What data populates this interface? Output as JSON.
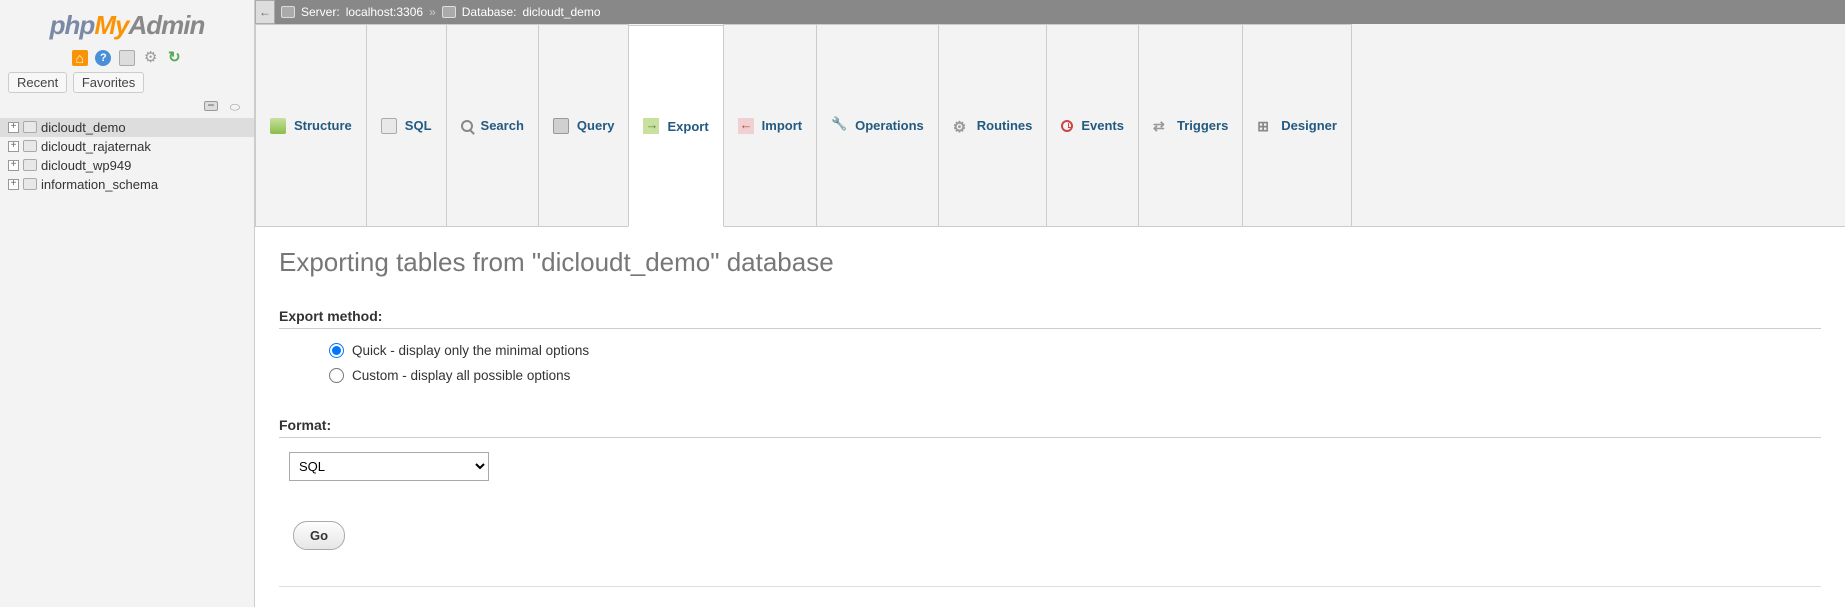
{
  "logo": {
    "part1": "php",
    "part2": "My",
    "part3": "Admin"
  },
  "sidebar": {
    "tabs": {
      "recent": "Recent",
      "favorites": "Favorites"
    },
    "databases": [
      {
        "name": "dicloudt_demo",
        "selected": true
      },
      {
        "name": "dicloudt_rajaternak",
        "selected": false
      },
      {
        "name": "dicloudt_wp949",
        "selected": false
      },
      {
        "name": "information_schema",
        "selected": false
      }
    ]
  },
  "breadcrumb": {
    "server_label": "Server:",
    "server_value": "localhost:3306",
    "db_label": "Database:",
    "db_value": "dicloudt_demo",
    "sep": "»"
  },
  "tabs": [
    {
      "key": "structure",
      "label": "Structure"
    },
    {
      "key": "sql",
      "label": "SQL"
    },
    {
      "key": "search",
      "label": "Search"
    },
    {
      "key": "query",
      "label": "Query"
    },
    {
      "key": "export",
      "label": "Export",
      "active": true
    },
    {
      "key": "import",
      "label": "Import"
    },
    {
      "key": "operations",
      "label": "Operations"
    },
    {
      "key": "routines",
      "label": "Routines"
    },
    {
      "key": "events",
      "label": "Events"
    },
    {
      "key": "triggers",
      "label": "Triggers"
    },
    {
      "key": "designer",
      "label": "Designer"
    }
  ],
  "page": {
    "title": "Exporting tables from \"dicloudt_demo\" database",
    "export_method_heading": "Export method:",
    "method_quick": "Quick - display only the minimal options",
    "method_custom": "Custom - display all possible options",
    "format_heading": "Format:",
    "format_value": "SQL",
    "go_button": "Go"
  }
}
